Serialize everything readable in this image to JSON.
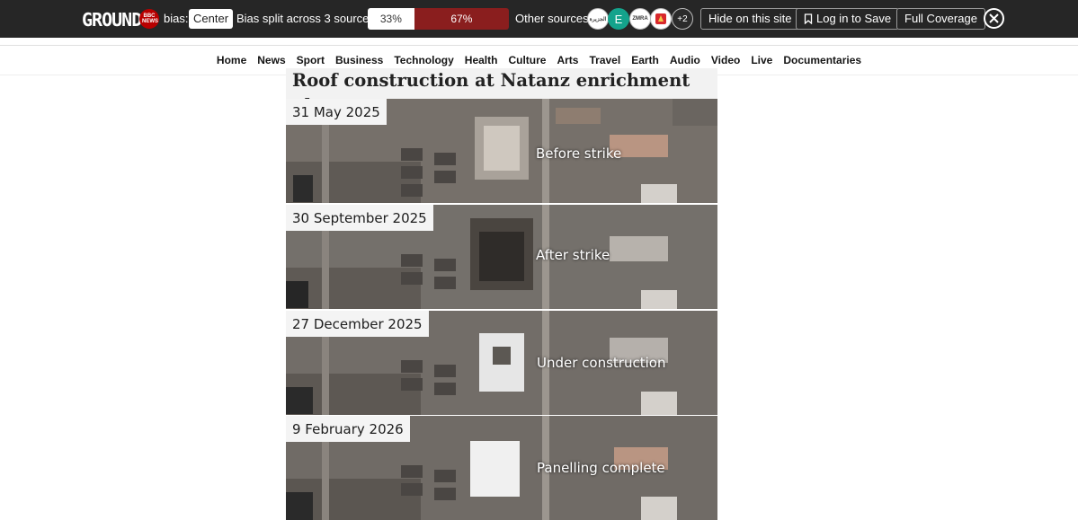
{
  "ground_bar": {
    "logo": "GROUND",
    "source_badge": "BBC NEWS",
    "bias_label": "bias:",
    "bias_value": "Center",
    "split_label": "Bias split across 3 sources",
    "split_left_pct": "33%",
    "split_right_pct": "67%",
    "split_left_fraction": 0.33,
    "split_colors": {
      "left": "#ffffff",
      "right": "#8a1e1e"
    },
    "other_sources_label": "Other sources",
    "source_icons": [
      {
        "icon": "al-jazeera-icon",
        "text": "الجزيرة"
      },
      {
        "icon": "e-source-icon",
        "text": "E"
      },
      {
        "icon": "zmra-source-icon",
        "text": "ZMRA"
      },
      {
        "icon": "red-logo-source-icon",
        "text": ""
      }
    ],
    "more_sources": "+2",
    "hide_button": "Hide on this site",
    "login_button": "Log in to Save",
    "coverage_button": "Full Coverage"
  },
  "nav": {
    "items": [
      "Home",
      "News",
      "Sport",
      "Business",
      "Technology",
      "Health",
      "Culture",
      "Arts",
      "Travel",
      "Earth",
      "Audio",
      "Video",
      "Live",
      "Documentaries"
    ]
  },
  "graphic": {
    "title": "Roof construction at Natanz enrichment plant",
    "panels": [
      {
        "date": "31 May 2025",
        "caption": "Before strike"
      },
      {
        "date": "30 September 2025",
        "caption": "After strike"
      },
      {
        "date": "27 December 2025",
        "caption": "Under construction"
      },
      {
        "date": "9 February 2026",
        "caption": "Panelling complete"
      }
    ]
  }
}
